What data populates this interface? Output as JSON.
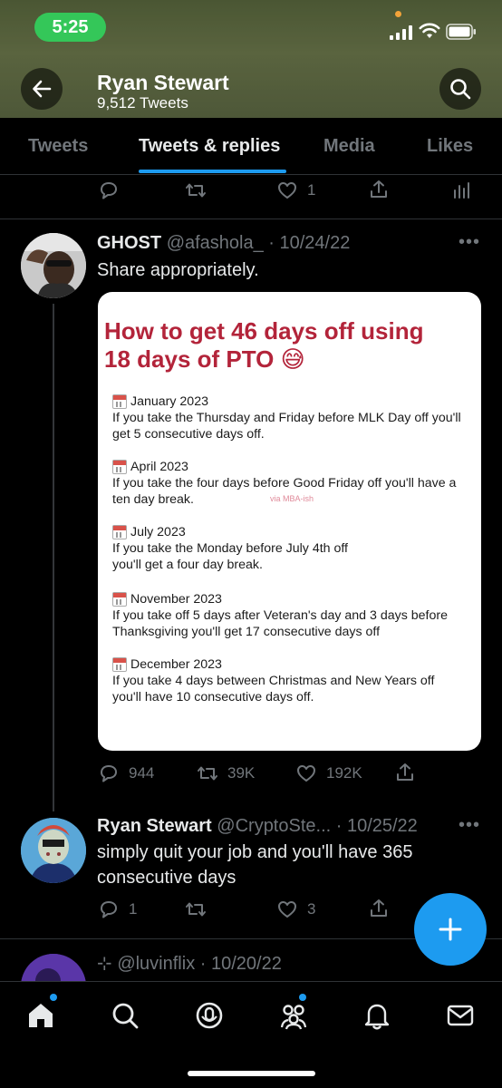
{
  "status_bar": {
    "time": "5:25"
  },
  "profile": {
    "name": "Ryan Stewart",
    "tweet_count": "9,512 Tweets"
  },
  "tabs": [
    {
      "label": "Tweets"
    },
    {
      "label": "Tweets & replies"
    },
    {
      "label": "Media"
    },
    {
      "label": "Likes"
    }
  ],
  "prev_tweet_actions": {
    "likes": "1"
  },
  "tweet1": {
    "name": "GHOST",
    "meta": "@afashola_ · 10/24/22",
    "text": "Share appropriately.",
    "card": {
      "title": "How to get 46 days off using 18 days of PTO 😅",
      "watermark": "via MBA-ish",
      "entries": [
        {
          "month": "January 2023",
          "text": "If you take the Thursday and Friday before MLK Day off you'll get 5 consecutive days off."
        },
        {
          "month": "April 2023",
          "text": "If you take the four days before Good Friday off you'll have a ten day break."
        },
        {
          "month": "July 2023",
          "text": "If you take the Monday before July 4th off you'll get a four day break."
        },
        {
          "month": "November 2023",
          "text": "If you take off 5 days after Veteran's day and 3 days before Thanksgiving you'll get 17 consecutive days off"
        },
        {
          "month": "December 2023",
          "text": "If you take 4 days between Christmas and New Years off you'll have 10 consecutive days off."
        }
      ]
    },
    "replies": "944",
    "retweets": "39K",
    "likes": "192K"
  },
  "tweet2": {
    "name": "Ryan Stewart",
    "meta": "@CryptoSte... · 10/25/22",
    "text": "simply quit your job and you'll have 365 consecutive days",
    "replies": "1",
    "likes": "3"
  },
  "tweet3": {
    "meta": "⊹ @luvinflix · 10/20/22"
  },
  "colors": {
    "accent": "#1d9bf0",
    "status_green": "#34c759",
    "card_title": "#b3243a"
  }
}
